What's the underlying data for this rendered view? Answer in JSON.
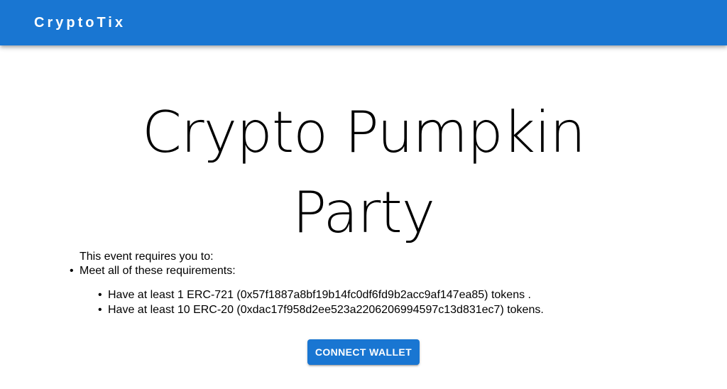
{
  "header": {
    "brand": "CryptoTix"
  },
  "event": {
    "title_line1": "Crypto Pumpkin",
    "title_line2": "Party"
  },
  "requirements": {
    "intro": "This event requires you to:",
    "group_label": "Meet all of these requirements:",
    "items": [
      "Have at least 1 ERC-721 (0x57f1887a8bf19b14fc0df6fd9b2acc9af147ea85) tokens .",
      "Have at least 10 ERC-20 (0xdac17f958d2ee523a2206206994597c13d831ec7) tokens."
    ]
  },
  "actions": {
    "connect_label": "CONNECT WALLET"
  },
  "colors": {
    "primary": "#1976d2",
    "text": "#000000",
    "background": "#ffffff"
  }
}
